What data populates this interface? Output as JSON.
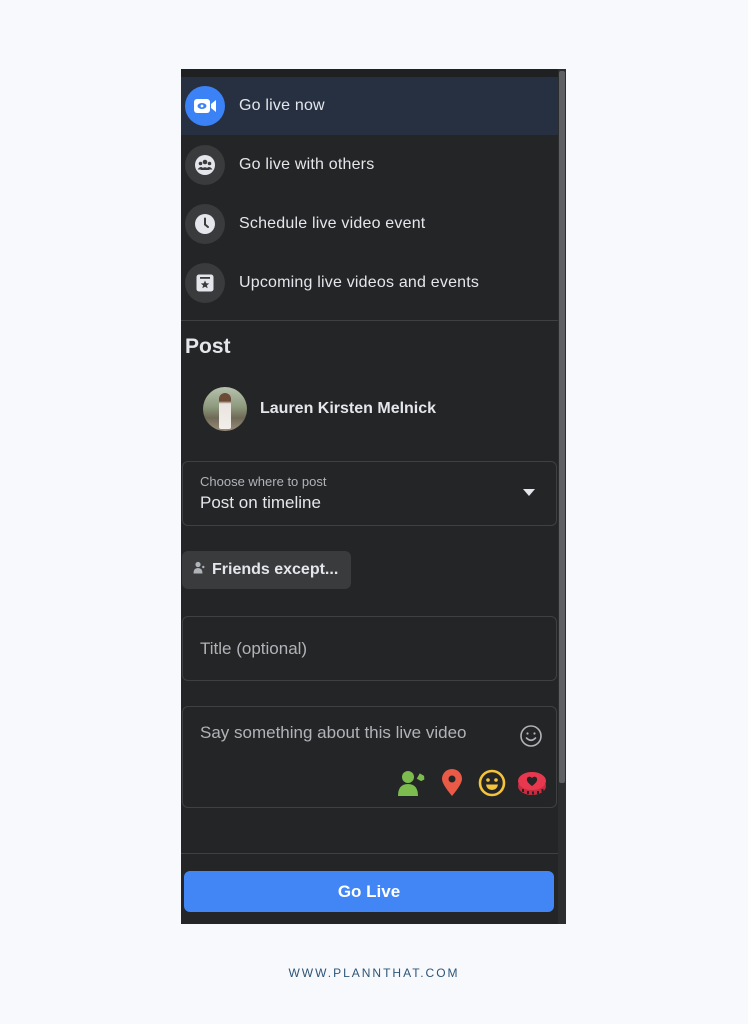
{
  "live_menu": {
    "items": [
      {
        "label": "Go live now",
        "icon": "video-camera-icon",
        "active": true
      },
      {
        "label": "Go live with others",
        "icon": "group-icon",
        "active": false
      },
      {
        "label": "Schedule live video event",
        "icon": "clock-icon",
        "active": false
      },
      {
        "label": "Upcoming live videos and events",
        "icon": "calendar-star-icon",
        "active": false
      }
    ]
  },
  "post": {
    "section_title": "Post",
    "author_name": "Lauren Kirsten Melnick",
    "destination": {
      "label": "Choose where to post",
      "value": "Post on timeline"
    },
    "audience": {
      "label": "Friends except...",
      "icon": "person-icon"
    },
    "title_field": {
      "placeholder": "Title (optional)",
      "value": ""
    },
    "description_field": {
      "placeholder": "Say something about this live video",
      "value": ""
    },
    "action_icons": [
      {
        "name": "tag-people-icon",
        "color": "#7cbc4f"
      },
      {
        "name": "location-pin-icon",
        "color": "#ea5a47"
      },
      {
        "name": "feeling-icon",
        "color": "#f5c33b"
      },
      {
        "name": "fundraiser-icon",
        "color": "#e8384f"
      }
    ]
  },
  "go_live_button": {
    "label": "Go Live"
  },
  "colors": {
    "accent": "#4285f4",
    "panel_bg": "#242526",
    "active_row_bg": "#263041"
  },
  "footer": {
    "text": "WWW.PLANNTHAT.COM"
  }
}
